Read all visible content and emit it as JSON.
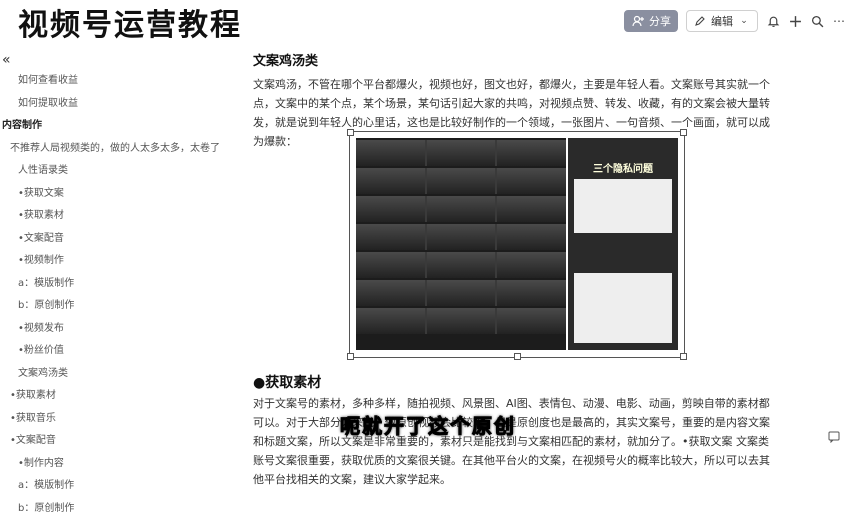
{
  "page": {
    "title": "视频号运营教程"
  },
  "toolbar": {
    "share_label": "分享",
    "edit_label": "编辑"
  },
  "sidebar": {
    "items": [
      {
        "label": "如何查看收益",
        "indent": 18,
        "bold": false
      },
      {
        "label": "如何提取收益",
        "indent": 18,
        "bold": false
      },
      {
        "label": "内容制作",
        "indent": 2,
        "bold": true
      },
      {
        "label": "不推荐人局视频类的，做的人太多太多，太卷了",
        "indent": 10,
        "bold": false
      },
      {
        "label": "人性语录类",
        "indent": 18,
        "bold": false
      },
      {
        "label": "•获取文案",
        "indent": 18,
        "bold": false
      },
      {
        "label": "•获取素材",
        "indent": 18,
        "bold": false
      },
      {
        "label": "•文案配音",
        "indent": 18,
        "bold": false
      },
      {
        "label": "•视频制作",
        "indent": 18,
        "bold": false
      },
      {
        "label": "a：模版制作",
        "indent": 18,
        "bold": false
      },
      {
        "label": "b：原创制作",
        "indent": 18,
        "bold": false
      },
      {
        "label": "•视频发布",
        "indent": 18,
        "bold": false
      },
      {
        "label": "•粉丝价值",
        "indent": 18,
        "bold": false
      },
      {
        "label": "文案鸡汤类",
        "indent": 18,
        "bold": false
      },
      {
        "label": "•获取素材",
        "indent": 10,
        "bold": false
      },
      {
        "label": "•获取音乐",
        "indent": 10,
        "bold": false
      },
      {
        "label": "•文案配音",
        "indent": 10,
        "bold": false
      },
      {
        "label": "•制作内容",
        "indent": 18,
        "bold": false
      },
      {
        "label": "a：模版制作",
        "indent": 18,
        "bold": false
      },
      {
        "label": "b：原创制作",
        "indent": 18,
        "bold": false
      }
    ]
  },
  "content": {
    "section_title": "文案鸡汤类",
    "paragraph1": "文案鸡汤，不管在哪个平台都爆火，视频也好，图文也好，都爆火，主要是年轻人看。文案账号其实就一个点，文案中的某个点，某个场景，某句话引起大家的共鸣，对视频点赞、转发、收藏，有的文案会被大量转发，就是说到年轻人的心里话，这也是比较好制作的一个领域，一张图片、一句音频、一个画面，就可以成为爆款：",
    "figure_panel_title": "三个隐私问题",
    "heading2": "●获取素材",
    "paragraph2": "对于文案号的素材，多种多样，随拍视频、风景图、AI图、表情包、动漫、电影、动画，剪映自带的素材都可以。对于大部分人来说，做原创视频会比较难，但是原创度也是最高的，其实文案号，重要的是内容文案和标题文案，所以文案是非常重要的，素材只是能找到与文案相匹配的素材，就加分了。•获取文案 文案类账号文案很重要，获取优质的文案很关键。在其他平台火的文案，在视频号火的概率比较大，所以可以去其他平台找相关的文案，建议大家学起来。"
  },
  "subtitle": "呃就开了这个原创"
}
